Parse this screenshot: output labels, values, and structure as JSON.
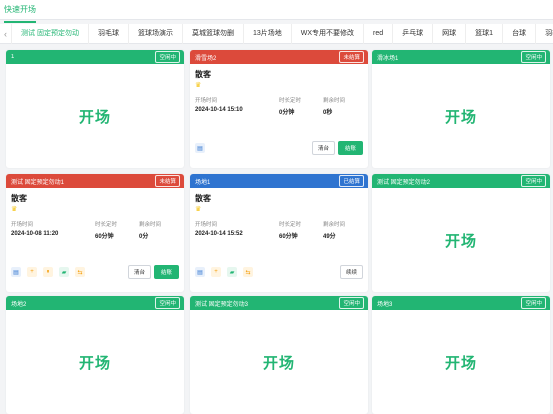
{
  "top_tab": "快速开场",
  "categories": [
    "测试 固定预定勿动",
    "羽毛球",
    "篮球场演示",
    "莫城篮球勿删",
    "13片场地",
    "WX专用不要修改",
    "red",
    "乒乓球",
    "网球",
    "篮球1",
    "台球",
    "羽毛"
  ],
  "open_label": "开场",
  "labels": {
    "start_time": "开场时间",
    "duration": "时长定时",
    "remaining": "剩余时间",
    "clear_table": "清台",
    "checkout": "结账",
    "renew": "续续"
  },
  "cards": [
    {
      "title": "1",
      "status": "空闲中"
    },
    {
      "title": "滑雪场2",
      "status": "未结算",
      "guest": "散客",
      "start_time": "2024-10-14 15:10",
      "duration": "0分钟",
      "remaining": "0秒"
    },
    {
      "title": "滑冰场1",
      "status": "空闲中"
    },
    {
      "title": "测试 固定预定勿动1",
      "status": "未结算",
      "guest": "散客",
      "start_time": "2024-10-08 11:20",
      "duration": "60分钟",
      "remaining": "0分"
    },
    {
      "title": "场地1",
      "status": "已结算",
      "guest": "散客",
      "start_time": "2024-10-14 15:52",
      "duration": "60分钟",
      "remaining": "49分"
    },
    {
      "title": "测试 固定预定勿动2",
      "status": "空闲中"
    },
    {
      "title": "场地2",
      "status": "空闲中"
    },
    {
      "title": "测试 固定预定勿动3",
      "status": "空闲中"
    },
    {
      "title": "场地3",
      "status": "空闲中"
    }
  ],
  "colors": {
    "green": "#22b573",
    "red": "#dc4a3b",
    "blue": "#2f74d0"
  }
}
